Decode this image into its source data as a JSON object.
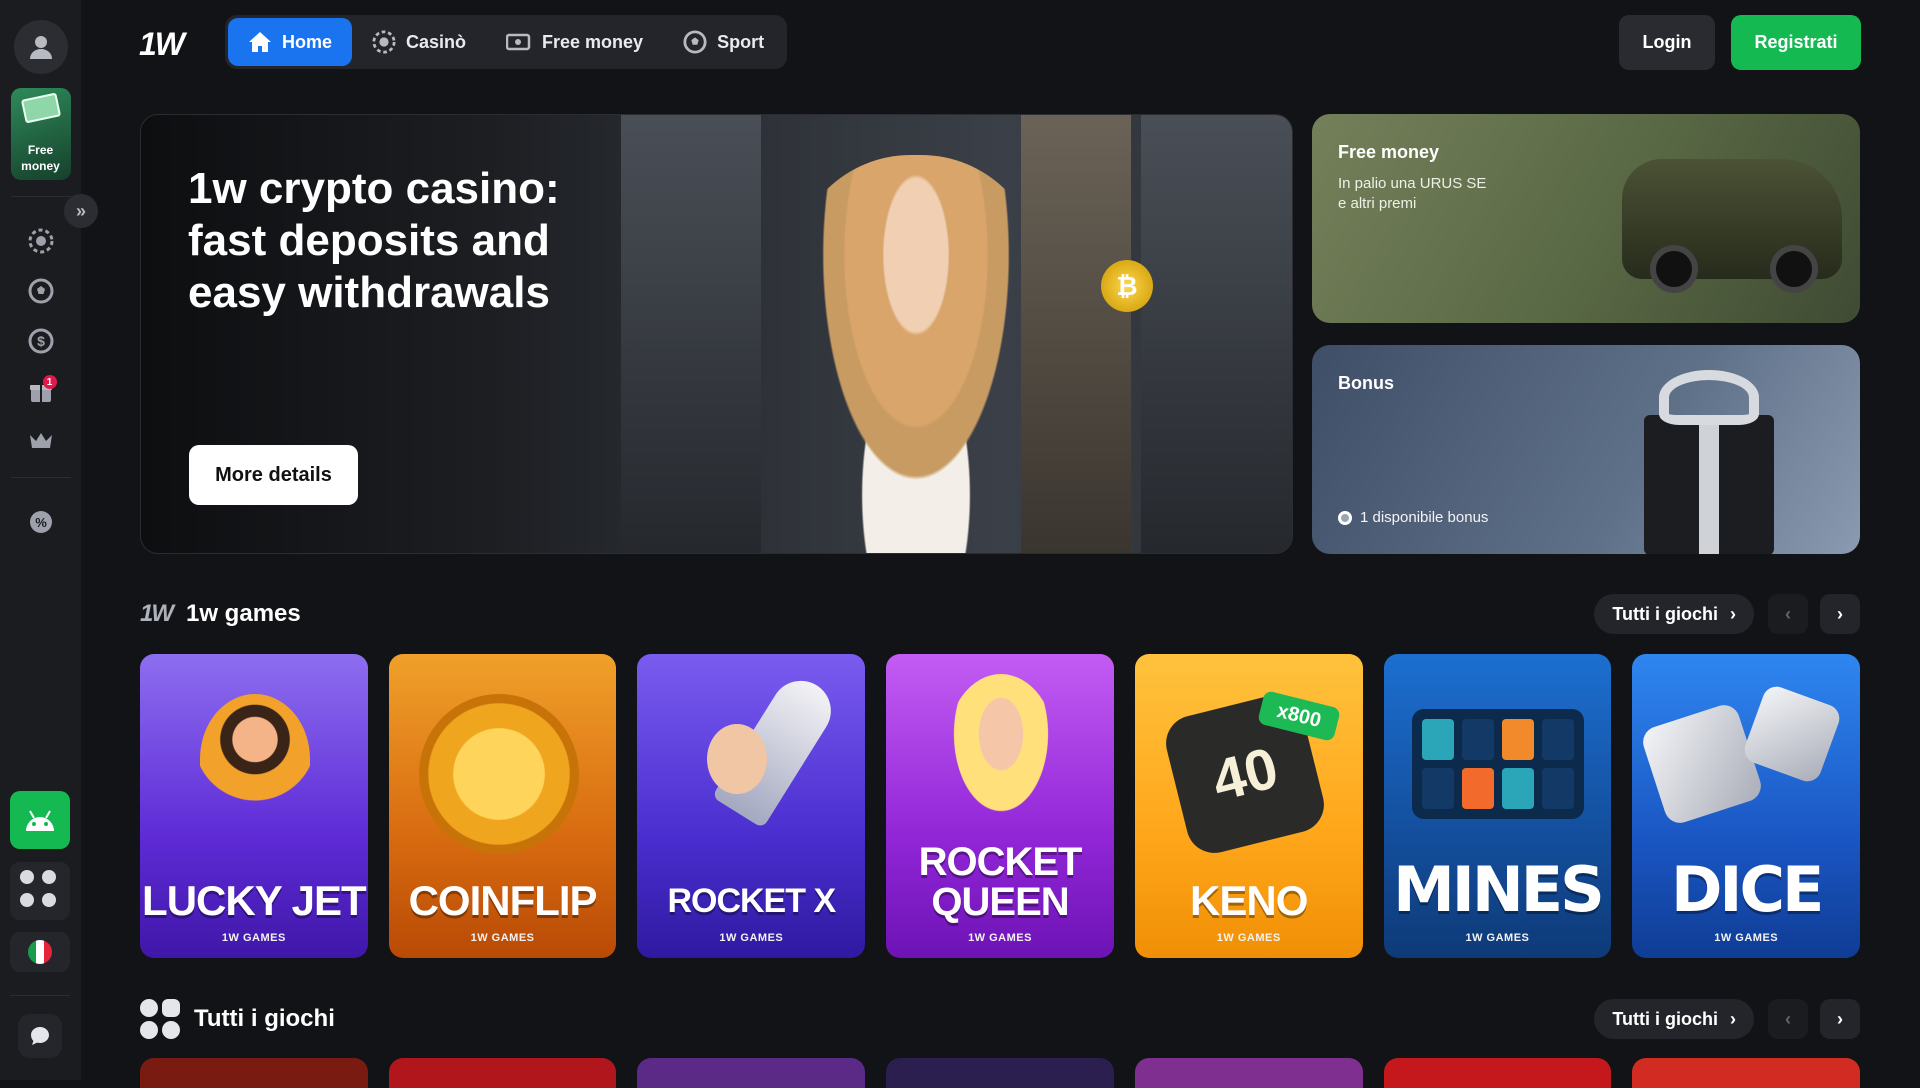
{
  "sidebar": {
    "free_money_label": "Free money",
    "gift_badge": "1"
  },
  "header": {
    "logo": "1W",
    "nav": [
      {
        "label": "Home",
        "icon": "home-icon",
        "active": true
      },
      {
        "label": "Casinò",
        "icon": "casino-chip-icon",
        "active": false
      },
      {
        "label": "Free money",
        "icon": "money-icon",
        "active": false
      },
      {
        "label": "Sport",
        "icon": "football-icon",
        "active": false
      }
    ],
    "login_label": "Login",
    "register_label": "Registrati"
  },
  "hero": {
    "title": "1w crypto casino: fast deposits and easy withdrawals",
    "button_label": "More details",
    "coin_symbol": "₿"
  },
  "promos": {
    "free_money": {
      "title": "Free money",
      "text": "In palio una URUS SE e altri premi"
    },
    "bonus": {
      "title": "Bonus",
      "count_text": "1 disponibile bonus"
    }
  },
  "sections": {
    "games_1w": {
      "logo": "1W",
      "title": "1w games",
      "all_label": "Tutti i giochi"
    },
    "all_games": {
      "title": "Tutti i giochi",
      "all_label": "Tutti i giochi"
    }
  },
  "games": [
    {
      "name": "Lucky Jet",
      "provider": "1W GAMES"
    },
    {
      "name": "Coinflip",
      "provider": "1W GAMES"
    },
    {
      "name": "Rocket X",
      "provider": "1W GAMES"
    },
    {
      "name": "Rocket Queen",
      "provider": "1W GAMES"
    },
    {
      "name": "Keno",
      "provider": "1W GAMES",
      "badge": "x800",
      "tile_number": "40"
    },
    {
      "name": "Mines",
      "provider": "1W GAMES"
    },
    {
      "name": "Dice",
      "provider": "1W GAMES"
    }
  ],
  "colors": {
    "background": "#121316",
    "sidebar": "#1b1c20",
    "accent_blue": "#1a74f0",
    "accent_green": "#14b951",
    "badge_red": "#e3174a"
  }
}
